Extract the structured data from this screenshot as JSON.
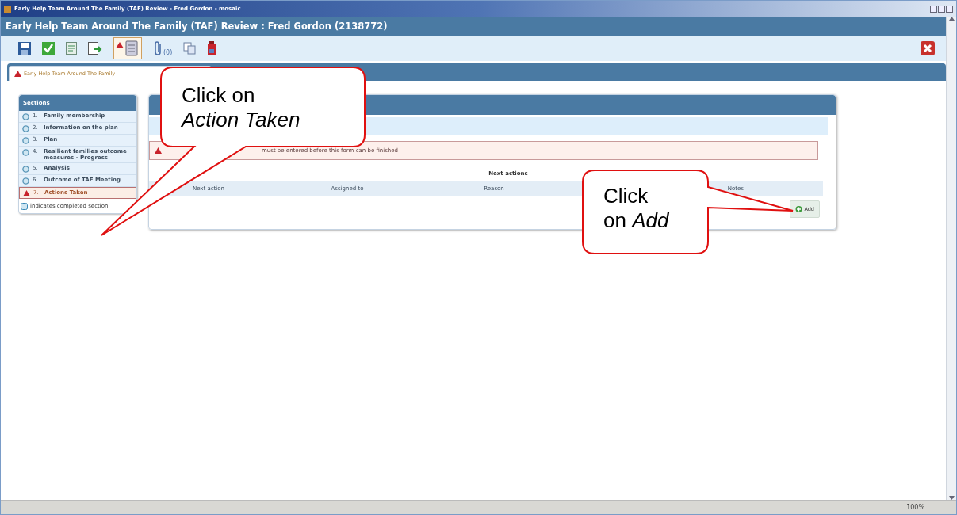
{
  "window": {
    "caption": "Early Help Team Around The Family (TAF) Review - Fred Gordon - mosaic",
    "title": "Early Help Team Around The Family (TAF) Review :  Fred Gordon  (2138772)"
  },
  "toolbar": {
    "attachment_count": "(0)"
  },
  "tabs": [
    {
      "label": "Early Help Team Around The Family",
      "warning": true,
      "selected": true
    }
  ],
  "sections": {
    "title": "Sections",
    "items": [
      {
        "number": "1.",
        "label": "Family membership",
        "completed": true,
        "selected": false
      },
      {
        "number": "2.",
        "label": "Information on the plan",
        "completed": true,
        "selected": false
      },
      {
        "number": "3.",
        "label": "Plan",
        "completed": true,
        "selected": false
      },
      {
        "number": "4.",
        "label": "Resilient families outcome measures - Progress",
        "completed": true,
        "selected": false
      },
      {
        "number": "5.",
        "label": "Analysis",
        "completed": true,
        "selected": false
      },
      {
        "number": "6.",
        "label": "Outcome of TAF Meeting",
        "completed": true,
        "selected": false
      },
      {
        "number": "7.",
        "label": "Actions Taken",
        "completed": false,
        "selected": true
      }
    ],
    "legend": "indicates completed section"
  },
  "panel": {
    "warning": "must be entered before this form can be finished",
    "table": {
      "title": "Next actions",
      "columns": [
        "Next action",
        "Assigned to",
        "Reason",
        "Notes"
      ],
      "add_button": "Add"
    }
  },
  "status_bar": {
    "zoom": "100%"
  },
  "callouts": [
    {
      "lines": [
        "Click on",
        "*Action Taken*"
      ]
    },
    {
      "lines": [
        "Click",
        "on *Add*"
      ]
    }
  ]
}
